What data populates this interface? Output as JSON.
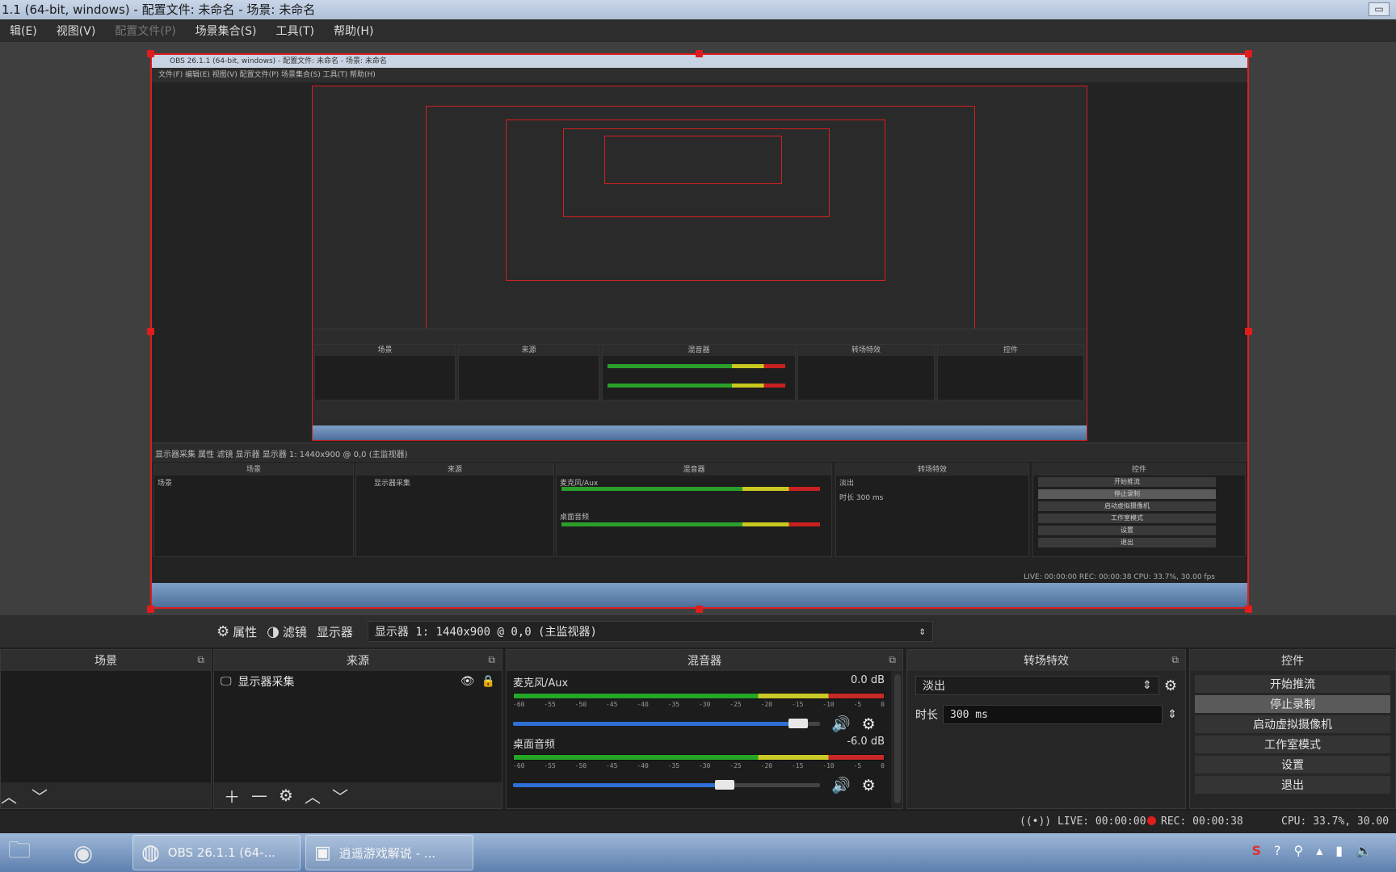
{
  "window": {
    "title": "1.1 (64-bit, windows) - 配置文件: 未命名 - 场景: 未命名",
    "restore_glyph": "▭"
  },
  "menu": [
    {
      "label": "辑(E)",
      "disabled": false
    },
    {
      "label": "视图(V)",
      "disabled": false
    },
    {
      "label": "配置文件(P)",
      "disabled": true
    },
    {
      "label": "场景集合(S)",
      "disabled": false
    },
    {
      "label": "工具(T)",
      "disabled": false
    },
    {
      "label": "帮助(H)",
      "disabled": false
    }
  ],
  "preview": {
    "mini_title": "OBS 26.1.1 (64-bit, windows) - 配置文件: 未命名 - 场景: 未命名",
    "mini_menu": "文件(F)    编辑(E)    视图(V)    配置文件(P)    场景集合(S)    工具(T)    帮助(H)",
    "mini_toolbar": "显示器采集              属性    滤镜    显示器    显示器 1: 1440x900 @ 0,0 (主监视器)",
    "mini_panels": {
      "scenes": "场景",
      "scene_item": "场景",
      "sources": "来源",
      "source_item": "显示器采集",
      "mixer": "混音器",
      "mic": "麦克风/Aux",
      "desktop": "桌面音频",
      "transitions": "转场特效",
      "fade": "淡出",
      "duration": "时长   300 ms",
      "controls": "控件",
      "buttons": [
        "开始推流",
        "停止录制",
        "启动虚拟摄像机",
        "工作室模式",
        "设置",
        "退出"
      ]
    },
    "mini_status": "LIVE: 00:00:00    REC: 00:00:38    CPU: 33.7%, 30.00 fps"
  },
  "toolbar": {
    "properties": "属性",
    "filters": "滤镜",
    "display_label": "显示器",
    "display_value": "显示器 1: 1440x900 @ 0,0 (主监视器)"
  },
  "scenes": {
    "title": "场景"
  },
  "sources": {
    "title": "来源",
    "items": [
      {
        "label": "显示器采集"
      }
    ]
  },
  "mixer": {
    "title": "混音器",
    "scale": [
      "-60",
      "-55",
      "-50",
      "-45",
      "-40",
      "-35",
      "-30",
      "-25",
      "-20",
      "-15",
      "-10",
      "-5",
      "0"
    ],
    "channels": [
      {
        "name": "麦克风/Aux",
        "db": "0.0 dB",
        "volume": 0.93
      },
      {
        "name": "桌面音频",
        "db": "-6.0 dB",
        "volume": 0.69
      }
    ]
  },
  "transitions": {
    "title": "转场特效",
    "selected": "淡出",
    "duration_label": "时长",
    "duration_value": "300 ms"
  },
  "controls": {
    "title": "控件",
    "buttons": [
      {
        "label": "开始推流",
        "active": false
      },
      {
        "label": "停止录制",
        "active": true
      },
      {
        "label": "启动虚拟摄像机",
        "active": false
      },
      {
        "label": "工作室模式",
        "active": false
      },
      {
        "label": "设置",
        "active": false
      },
      {
        "label": "退出",
        "active": false
      }
    ]
  },
  "status": {
    "live": "LIVE: 00:00:00",
    "rec": "REC: 00:00:38",
    "cpu": "CPU: 33.7%, 30.00"
  },
  "taskbar": {
    "apps": [
      {
        "label": "OBS 26.1.1 (64-..."
      },
      {
        "label": "逍遥游戏解说 - ..."
      }
    ]
  },
  "colors": {
    "accent": "#e01c1c",
    "slider": "#2f6fd6"
  }
}
